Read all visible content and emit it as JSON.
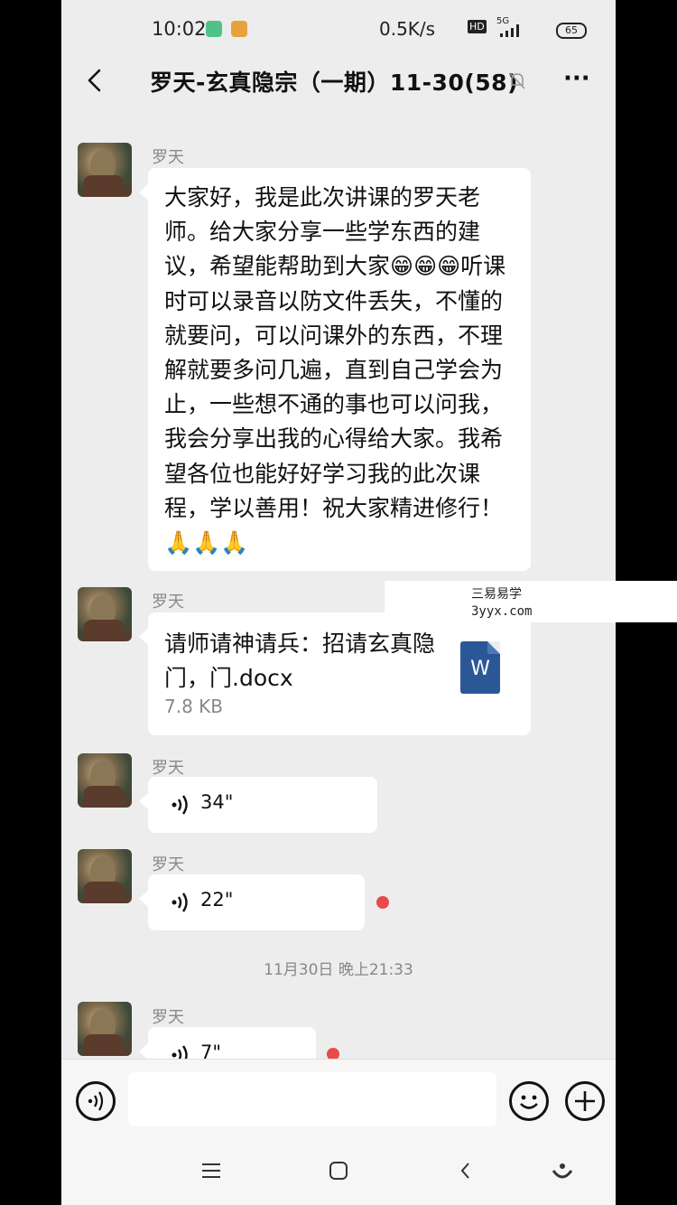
{
  "status_bar": {
    "time": "10:02",
    "net_speed": "0.5K/s",
    "network": "5G",
    "battery": "65"
  },
  "header": {
    "title": "罗天-玄真隐宗（一期）11-30(58)"
  },
  "messages": [
    {
      "sender": "罗天",
      "text": "大家好，我是此次讲课的罗天老师。给大家分享一些学东西的建议，希望能帮助到大家😁😁😁听课时可以录音以防文件丢失，不懂的就要问，可以问课外的东西，不理解就要多问几遍，直到自己学会为止，一些想不通的事也可以问我，我会分享出我的心得给大家。我希望各位也能好好学习我的此次课程，学以善用！祝大家精进修行！🙏🙏🙏"
    },
    {
      "sender": "罗天",
      "file_name": "请师请神请兵：招请玄真隐门，门.docx",
      "file_size": "7.8 KB",
      "file_icon": "W"
    },
    {
      "sender": "罗天",
      "voice_duration": "34\""
    },
    {
      "sender": "罗天",
      "voice_duration": "22\""
    },
    {
      "sender": "罗天",
      "voice_duration": "7\""
    }
  ],
  "timestamp": "11月30日 晚上21:33",
  "watermark": {
    "line1": "三易易学",
    "line2": "3yyx.com"
  },
  "colors": {
    "chat_bg": "#ededed",
    "bubble": "#ffffff",
    "unread_dot": "#e84a4a",
    "word_icon": "#2b5797"
  },
  "icons": [
    "back-icon",
    "mute-icon",
    "more-icon",
    "voice-wave-icon",
    "emoji-icon",
    "plus-icon",
    "menu-icon",
    "home-icon",
    "nav-back-icon",
    "assistant-icon"
  ]
}
